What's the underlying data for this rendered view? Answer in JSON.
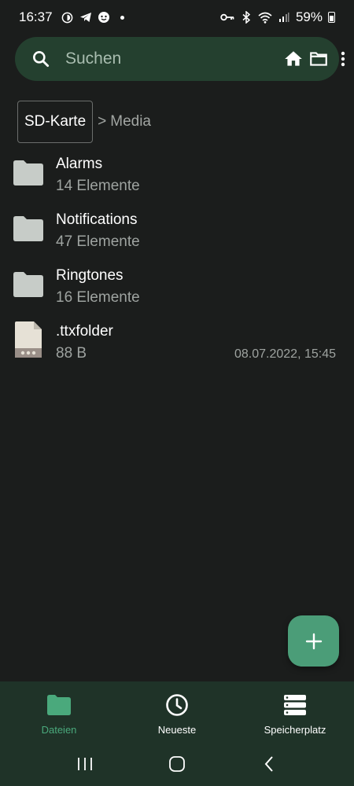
{
  "status_bar": {
    "time": "16:37",
    "battery": "59%",
    "icons": [
      "data-saver-icon",
      "telegram-icon",
      "face-icon",
      "notification-dot-icon",
      "vpn-key-icon",
      "bluetooth-icon",
      "wifi-icon",
      "signal-icon",
      "battery-icon"
    ]
  },
  "search": {
    "placeholder": "Suchen",
    "icons": [
      "search-icon",
      "home-icon",
      "folder-icon",
      "more-vert-icon"
    ]
  },
  "breadcrumb": {
    "root": "SD-Karte",
    "separator": ">",
    "current": "Media"
  },
  "files": [
    {
      "name": "Alarms",
      "meta": "14 Elemente",
      "date": "",
      "icon": "folder-icon"
    },
    {
      "name": "Notifications",
      "meta": "47 Elemente",
      "date": "",
      "icon": "folder-icon"
    },
    {
      "name": "Ringtones",
      "meta": "16 Elemente",
      "date": "",
      "icon": "folder-icon"
    },
    {
      "name": ".ttxfolder",
      "meta": "88 B",
      "date": "08.07.2022, 15:45",
      "icon": "file-icon"
    }
  ],
  "fab": {
    "icon": "add-icon"
  },
  "bottom_nav": {
    "items": [
      {
        "label": "Dateien",
        "icon": "folder-icon",
        "active": true
      },
      {
        "label": "Neueste",
        "icon": "clock-icon",
        "active": false
      },
      {
        "label": "Speicherplatz",
        "icon": "storage-icon",
        "active": false
      }
    ]
  },
  "colors": {
    "background": "#1b1d1c",
    "search_bar": "#24402f",
    "accent": "#4b9d78",
    "nav_background": "#1f3328",
    "folder_icon": "#c7ccc8"
  }
}
